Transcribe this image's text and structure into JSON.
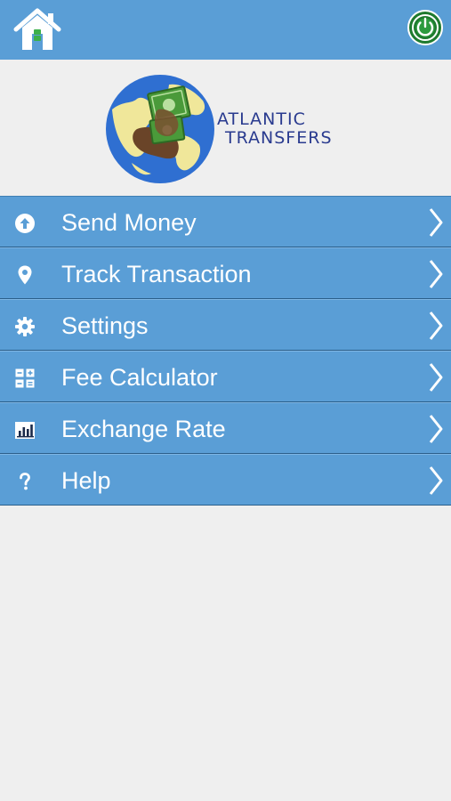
{
  "header": {
    "home_icon": "home-icon",
    "power_icon": "power-icon"
  },
  "logo": {
    "line1": "ATLANTIC",
    "line2": "TRANSFERS"
  },
  "menu": {
    "items": [
      {
        "label": "Send Money",
        "icon": "upload-circle-icon"
      },
      {
        "label": "Track Transaction",
        "icon": "location-pin-icon"
      },
      {
        "label": "Settings",
        "icon": "gear-icon"
      },
      {
        "label": "Fee Calculator",
        "icon": "calculator-icon"
      },
      {
        "label": "Exchange Rate",
        "icon": "bar-chart-icon"
      },
      {
        "label": "Help",
        "icon": "question-mark-icon"
      }
    ]
  },
  "colors": {
    "header_bg": "#5a9ed6",
    "menu_bg": "#5a9ed6",
    "page_bg": "#efefef",
    "logo_text": "#2a3b8f"
  }
}
